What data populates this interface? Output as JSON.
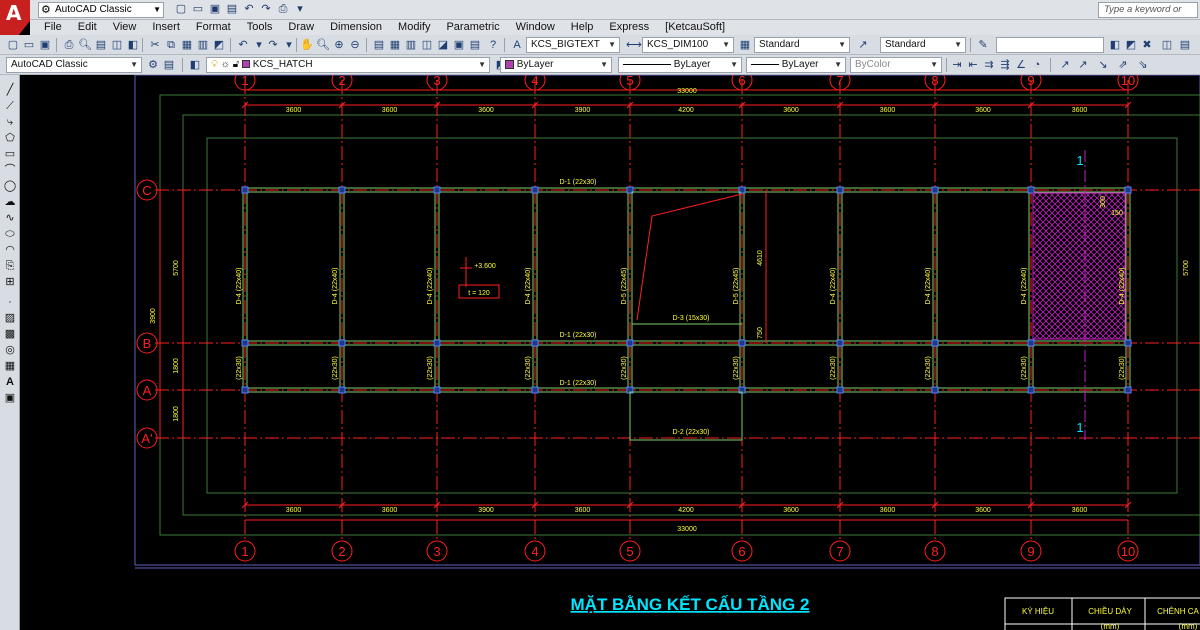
{
  "titlebar": {
    "workspace": "AutoCAD Classic",
    "search_placeholder": "Type a keyword or phrase"
  },
  "menu": [
    "File",
    "Edit",
    "View",
    "Insert",
    "Format",
    "Tools",
    "Draw",
    "Dimension",
    "Modify",
    "Parametric",
    "Window",
    "Help",
    "Express",
    "[KetcauSoft]"
  ],
  "toolbar1": {
    "text_style": "KCS_BIGTEXT",
    "dim_style": "KCS_DIM100",
    "table_style": "Standard",
    "multileader_style": "Standard"
  },
  "toolbar2": {
    "workspace": "AutoCAD Classic",
    "layer": "KCS_HATCH",
    "color": "ByLayer",
    "linetype": "ByLayer",
    "lineweight": "ByLayer",
    "plotstyle": "ByColor"
  },
  "drawing": {
    "title": "MẶT BẰNG KẾT CẤU TẦNG 2",
    "top_axis_labels": [
      "1",
      "2",
      "3",
      "4",
      "5",
      "6",
      "7",
      "8",
      "9",
      "10"
    ],
    "bottom_axis_labels": [
      "1",
      "2",
      "3",
      "4",
      "5",
      "6",
      "7",
      "8",
      "9",
      "10"
    ],
    "row_axis_labels": [
      "C",
      "B",
      "A",
      "A'"
    ],
    "top_dims": [
      "3600",
      "3600",
      "3600",
      "3900",
      "4200",
      "3600",
      "3600",
      "3600",
      "3600"
    ],
    "bottom_dims": [
      "3600",
      "3600",
      "3900",
      "3600",
      "4200",
      "3600",
      "3600",
      "3600",
      "3600"
    ],
    "overall_dim_top": "33000",
    "overall_dim_bottom": "33000",
    "left_dims": [
      "5700",
      "3900",
      "1800",
      "1800"
    ],
    "right_dim": "5700",
    "beams": {
      "top": "D-1 (22x30)",
      "mid": "D-1 (22x30)",
      "lower": "D-1 (22x30)",
      "stair": "D-3 (15x30)",
      "bottom": "D-2 (22x30)"
    },
    "vertical_beams": [
      "D-4 (22x40)",
      "D-4 (22x40)",
      "D-4 (22x40)",
      "D-4 (22x40)",
      "D-5 (22x45)",
      "D-5 (22x45)",
      "D-4 (22x40)",
      "D-4 (22x40)",
      "D-4 (22x40)",
      "D-4 (22x40)"
    ],
    "short_beams": [
      "(22x30)",
      "(22x30)",
      "(22x30)",
      "(22x30)",
      "(22x30)",
      "(22x30)",
      "(22x30)",
      "(22x30)",
      "(22x30)",
      "(22x30)"
    ],
    "elevation": "+3.600",
    "slab_thickness": "t = 120",
    "stair_dims": [
      "4610",
      "750"
    ],
    "hatch_dims": [
      "300",
      "150"
    ],
    "section_marks": [
      "1",
      "1"
    ],
    "legend_headers": [
      "KÝ HIỆU",
      "CHIỀU DÀY",
      "CHÊNH CA"
    ],
    "legend_subheaders": [
      "(mm)",
      "(mm)"
    ]
  },
  "colors": {
    "cad_bg": "#000000",
    "axis_red": "#ff2020",
    "beam_yellow": "#ffff3a",
    "dim_green": "#2aa84a",
    "title_cyan": "#00e5ff",
    "hatch_magenta": "#c020c0"
  }
}
